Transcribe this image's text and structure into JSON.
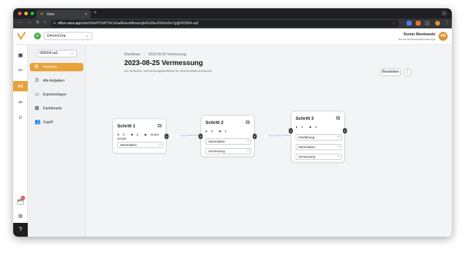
{
  "browser": {
    "tab_title": "Vaira",
    "url_host": "office.vaira.app",
    "url_path": "/o/kxO0mPl73dYTkCn6adE/workflows/cjk42x2buJF0n0e0m7g@000004-va2",
    "colors": {
      "dot_red": "#ff5f57",
      "dot_yellow": "#febc2e",
      "dot_green": "#28c840"
    }
  },
  "header": {
    "org_initial": "D",
    "org_name": "DennisCorp.",
    "user_name": "Dennis Bienkowski",
    "user_email": "dennis.bienkowski@vaira.app",
    "avatar_initials": "DB"
  },
  "rail": {
    "badge_count": "1"
  },
  "sidebar": {
    "workflow_select": "000004-va2",
    "items": [
      {
        "label": "Vorschau",
        "icon": "flow-icon"
      },
      {
        "label": "Alle Aufgaben",
        "icon": "list-icon"
      },
      {
        "label": "Exportvorlagen",
        "icon": "document-icon"
      },
      {
        "label": "Dashboards",
        "icon": "grid-icon"
      },
      {
        "label": "Zugriff",
        "icon": "users-icon"
      }
    ]
  },
  "main": {
    "breadcrumb": [
      "Workflows",
      "2023-08-25 Vermessung"
    ],
    "title": "2023-08-25 Vermessung",
    "description": "Ein einfacher Vermessungsworkflow für Demonstrationszwecke.",
    "edit_label": "Bearbeiten",
    "more_label": "⋮"
  },
  "steps": [
    {
      "title": "Schritt 1",
      "tasks": "0",
      "docs": "2",
      "start_label": "Erster Schritt",
      "rows": [
        "Stammdaten"
      ]
    },
    {
      "title": "Schritt 2",
      "tasks": "0",
      "docs": "2",
      "rows": [
        "Stammdaten",
        "Vermessung"
      ]
    },
    {
      "title": "Schritt 3",
      "tasks": "4",
      "docs": "2",
      "rows": [
        "Pastführung",
        "Stammdaten",
        "Vermessung"
      ]
    }
  ],
  "accent_color": "#e8a23a"
}
